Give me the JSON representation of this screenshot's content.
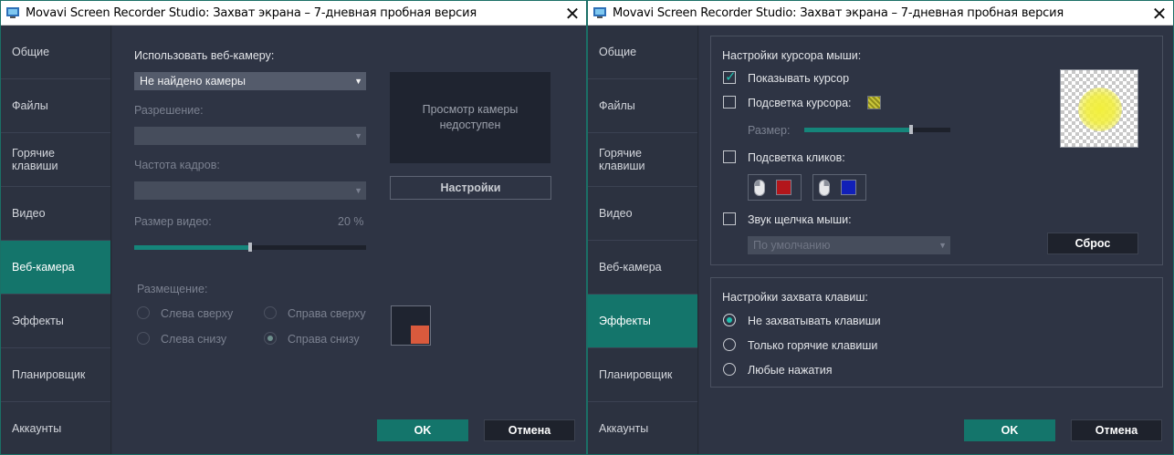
{
  "windows": {
    "left": {
      "title": "Movavi Screen Recorder Studio: Захват экрана – 7-дневная пробная версия",
      "sidebar": [
        "Общие",
        "Файлы",
        "Горячие клавиши",
        "Видео",
        "Веб-камера",
        "Эффекты",
        "Планировщик",
        "Аккаунты"
      ],
      "active_item": "Веб-камера",
      "webcam": {
        "use_label": "Использовать веб-камеру:",
        "camera_value": "Не найдено камеры",
        "resolution_label": "Разрешение:",
        "framerate_label": "Частота кадров:",
        "video_size_label": "Размер видео:",
        "video_size_value": "20 %",
        "video_size_fraction": 0.5,
        "preview_text": "Просмотр камеры недоступен",
        "settings_button": "Настройки",
        "placement_label": "Размещение:",
        "placement_options": [
          "Слева сверху",
          "Справа сверху",
          "Слева снизу",
          "Справа снизу"
        ],
        "placement_selected": "Справа снизу"
      },
      "ok_button": "OK",
      "cancel_button": "Отмена"
    },
    "right": {
      "title": "Movavi Screen Recorder Studio: Захват экрана – 7-дневная пробная версия",
      "sidebar": [
        "Общие",
        "Файлы",
        "Горячие клавиши",
        "Видео",
        "Веб-камера",
        "Эффекты",
        "Планировщик",
        "Аккаунты"
      ],
      "active_item": "Эффекты",
      "cursor": {
        "group_title": "Настройки курсора мыши:",
        "show_cursor": "Показывать курсор",
        "show_cursor_checked": true,
        "highlight_cursor": "Подсветка курсора:",
        "size_label": "Размер:",
        "size_fraction": 0.73,
        "highlight_clicks": "Подсветка кликов:",
        "click_sound": "Звук щелчка мыши:",
        "sound_value": "По умолчанию",
        "reset_button": "Сброс"
      },
      "keys": {
        "group_title": "Настройки захвата клавиш:",
        "options": [
          "Не захватывать клавиши",
          "Только горячие клавиши",
          "Любые нажатия"
        ],
        "selected": "Не захватывать клавиши"
      },
      "ok_button": "OK",
      "cancel_button": "Отмена"
    }
  },
  "colors": {
    "accent": "#14756b",
    "left_click_color": "#b3161b",
    "right_click_color": "#1120b8",
    "highlight_color": "#f2ef3c",
    "webcam_pip_color": "#d95a3d"
  },
  "icons": [
    "movavi-app-icon",
    "close-icon",
    "dropdown-arrow-icon",
    "mouse-left-icon",
    "mouse-right-icon",
    "checkmark-icon"
  ]
}
